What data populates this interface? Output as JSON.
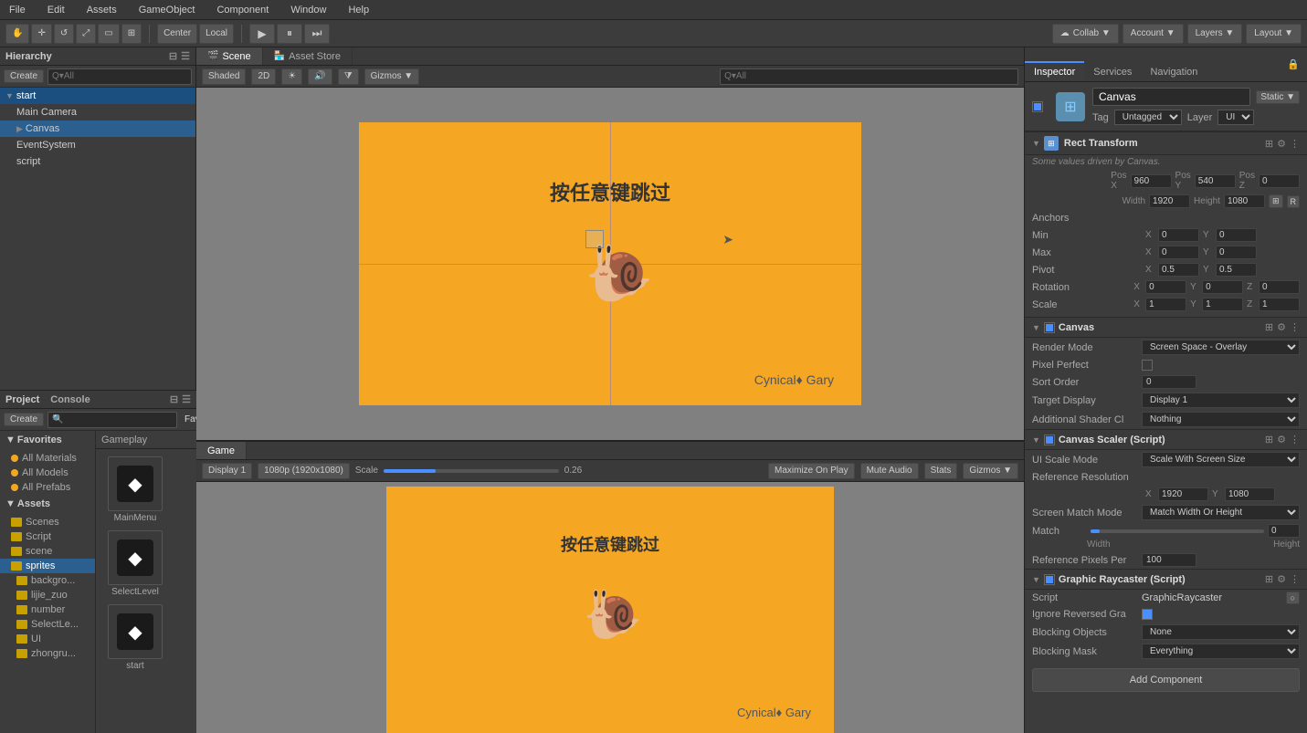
{
  "menubar": {
    "items": [
      "File",
      "Edit",
      "Assets",
      "GameObject",
      "Component",
      "Window",
      "Help"
    ]
  },
  "toolbar": {
    "transform_tools": [
      "hand",
      "move",
      "rotate",
      "scale",
      "rect",
      "combo"
    ],
    "pivot_labels": [
      "Center",
      "Local"
    ],
    "play_pause_stop": [
      "▶",
      "⏸",
      "⏭"
    ],
    "collab_label": "Collab ▼",
    "account_label": "Account ▼",
    "layers_label": "Layers ▼",
    "layout_label": "Layout ▼"
  },
  "hierarchy": {
    "title": "Hierarchy",
    "create_label": "Create",
    "search_placeholder": "Q▾All",
    "items": [
      {
        "label": "▼ start",
        "level": 0,
        "active": true
      },
      {
        "label": "Main Camera",
        "level": 1
      },
      {
        "label": "▶ Canvas",
        "level": 1,
        "selected": true
      },
      {
        "label": "EventSystem",
        "level": 1
      },
      {
        "label": "script",
        "level": 1
      }
    ]
  },
  "scene_view": {
    "tabs": [
      {
        "label": "Scene",
        "icon": "🎬",
        "active": true
      },
      {
        "label": "Asset Store",
        "icon": "🏪"
      }
    ],
    "shading": "Shaded",
    "mode_2d": "2D",
    "gizmos_label": "Gizmos ▼",
    "search_placeholder": "Q▾All",
    "canvas_text": "按任意键跳过",
    "credit_text": "Cynical♦ Gary",
    "grid_lines": true
  },
  "game_view": {
    "tab_label": "Game",
    "display": "Display 1",
    "resolution": "1080p (1920x1080)",
    "scale": "Scale",
    "scale_value": "0.26",
    "maximize_label": "Maximize On Play",
    "mute_label": "Mute Audio",
    "stats_label": "Stats",
    "gizmos_label": "Gizmos ▼",
    "canvas_text": "按任意键跳过",
    "credit_text": "Cynical♦ Gary"
  },
  "project": {
    "tabs": [
      "Project",
      "Console"
    ],
    "create_label": "Create",
    "search_placeholder": "🔍",
    "breadcrumb": "Gameplay",
    "favorites": {
      "label": "Favorites",
      "items": [
        "All Materials",
        "All Models",
        "All Prefabs"
      ]
    },
    "assets": {
      "label": "Assets",
      "items": [
        "Scenes",
        "Script",
        "scene",
        "sprites",
        "backgrounds",
        "lijie_zuo",
        "number",
        "SelectLe...",
        "UI",
        "zhongru..."
      ]
    },
    "content": [
      {
        "label": "MainMenu",
        "type": "unity"
      },
      {
        "label": "SelectLevel",
        "type": "unity"
      },
      {
        "label": "start",
        "type": "unity"
      }
    ]
  },
  "inspector": {
    "tabs": [
      "Inspector",
      "Services",
      "Navigation"
    ],
    "object": {
      "name": "Canvas",
      "tag": "Untagged",
      "layer": "UI",
      "static": "Static ▼",
      "enabled_checkbox": true
    },
    "rect_transform": {
      "section_name": "Rect Transform",
      "note": "Some values driven by Canvas.",
      "pos_x": "960",
      "pos_y": "540",
      "pos_z": "0",
      "width": "1920",
      "height": "1080",
      "anchors_label": "Anchors",
      "min_x": "0",
      "min_y": "0",
      "max_x": "0",
      "max_y": "0",
      "pivot_x": "0.5",
      "pivot_y": "0.5",
      "rotation_x": "0",
      "rotation_y": "0",
      "rotation_z": "0",
      "scale_x": "1",
      "scale_y": "1",
      "scale_z": "1"
    },
    "canvas": {
      "section_name": "Canvas",
      "render_mode": "Screen Space - Overlay",
      "pixel_perfect": false,
      "sort_order": "0",
      "target_display": "Display 1",
      "additional_shader": "Nothing"
    },
    "canvas_scaler": {
      "section_name": "Canvas Scaler (Script)",
      "ui_scale_mode": "Scale With Screen Size",
      "ref_res_x": "1920",
      "ref_res_y": "1080",
      "screen_match_mode": "Match Width Or Height",
      "match_label": "Match",
      "width_label": "Width",
      "height_label": "Height",
      "match_value": "0",
      "ref_pixels": "100"
    },
    "graphic_raycaster": {
      "section_name": "Graphic Raycaster (Script)",
      "script": "GraphicRaycaster",
      "ignore_reversed": true,
      "blocking_objects": "None",
      "blocking_mask": "Everything"
    },
    "add_component_label": "Add Component"
  },
  "icons": {
    "unity": "◆",
    "folder": "📁",
    "scene": "🎬",
    "lock": "🔒",
    "settings": "⚙",
    "arrow_right": "▶",
    "arrow_down": "▼",
    "search": "🔍"
  }
}
